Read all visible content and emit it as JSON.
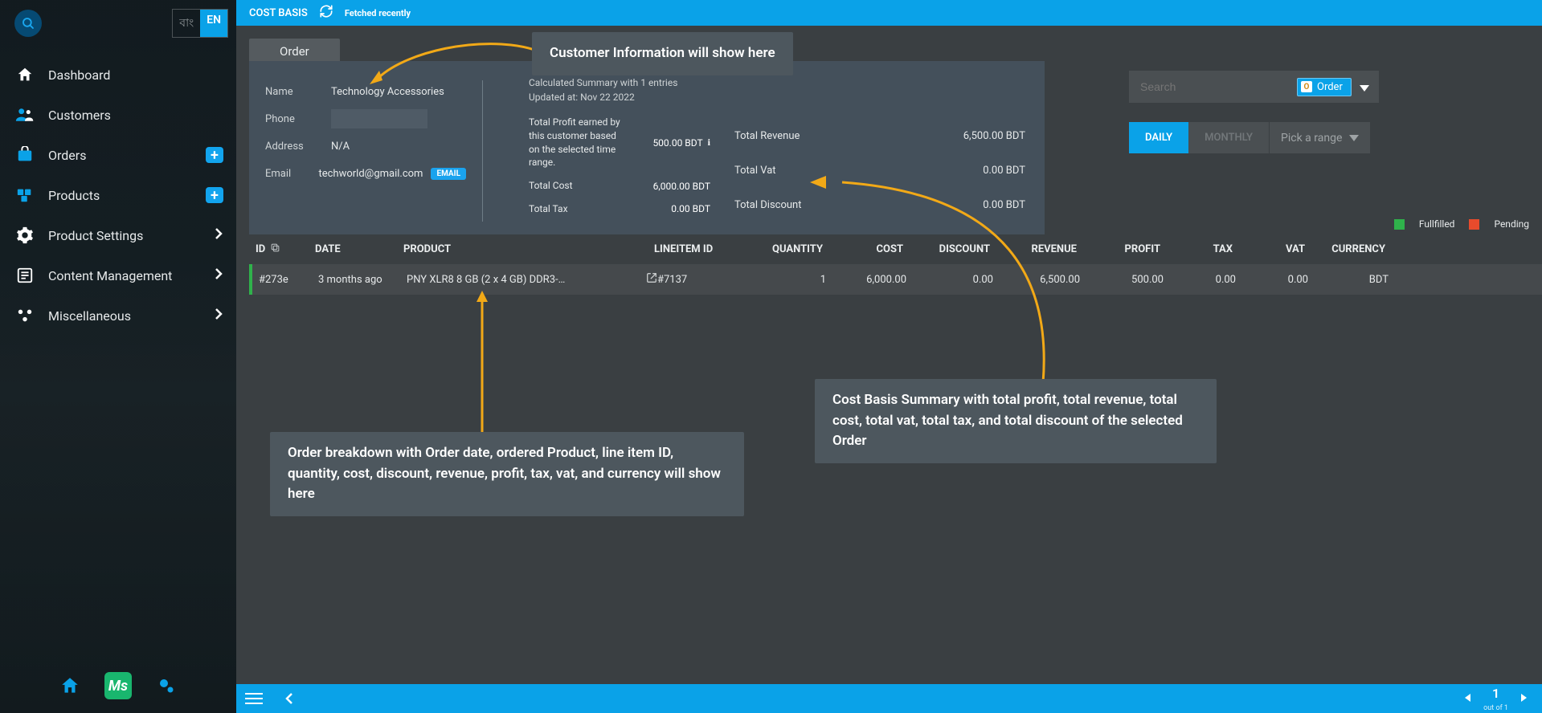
{
  "colors": {
    "accent": "#0aa2e8",
    "fulfilled": "#2fb24b",
    "pending": "#e84b2c"
  },
  "lang": {
    "inactive": "বাং",
    "active": "EN"
  },
  "sidebar": {
    "items": [
      {
        "icon": "home",
        "label": "Dashboard"
      },
      {
        "icon": "users",
        "label": "Customers"
      },
      {
        "icon": "orders",
        "label": "Orders",
        "plus": true
      },
      {
        "icon": "products",
        "label": "Products",
        "plus": true
      },
      {
        "icon": "settings",
        "label": "Product Settings",
        "chev": true
      },
      {
        "icon": "content",
        "label": "Content Management",
        "chev": true
      },
      {
        "icon": "misc",
        "label": "Miscellaneous",
        "chev": true
      }
    ]
  },
  "topbar": {
    "title": "COST BASIS",
    "fetch": "Fetched recently"
  },
  "chip": "Order",
  "customer": {
    "name_label": "Name",
    "name": "Technology Accessories",
    "phone_label": "Phone",
    "address_label": "Address",
    "address": "N/A",
    "email_label": "Email",
    "email": "techworld@gmail.com",
    "email_badge": "EMAIL"
  },
  "summary": {
    "line1": "Calculated Summary with 1 entries",
    "line2": "Updated at: Nov 22 2022",
    "profit_label": "Total Profit earned by this customer based on the selected time range.",
    "profit_value": "500.00 BDT",
    "cost_label": "Total Cost",
    "cost_value": "6,000.00 BDT",
    "tax_label": "Total Tax",
    "tax_value": "0.00 BDT",
    "revenue_label": "Total Revenue",
    "revenue_value": "6,500.00 BDT",
    "vat_label": "Total Vat",
    "vat_value": "0.00 BDT",
    "discount_label": "Total Discount",
    "discount_value": "0.00 BDT"
  },
  "search": {
    "placeholder": "Search",
    "badge_letter": "O",
    "badge_text": "Order"
  },
  "range": {
    "daily": "DAILY",
    "monthly": "MONTHLY",
    "pick": "Pick a range"
  },
  "legend": {
    "fulfilled": "Fullfilled",
    "pending": "Pending"
  },
  "table": {
    "headers": [
      "ID",
      "DATE",
      "PRODUCT",
      "LINEITEM ID",
      "QUANTITY",
      "COST",
      "DISCOUNT",
      "REVENUE",
      "PROFIT",
      "TAX",
      "VAT",
      "CURRENCY"
    ],
    "rows": [
      {
        "id": "#273e",
        "date": "3 months ago",
        "product": "PNY XLR8 8 GB (2 x 4 GB) DDR3-…",
        "lineitem": "#7137",
        "qty": "1",
        "cost": "6,000.00",
        "discount": "0.00",
        "revenue": "6,500.00",
        "profit": "500.00",
        "tax": "0.00",
        "vat": "0.00",
        "currency": "BDT"
      }
    ]
  },
  "tooltips": {
    "top": "Customer Information will show here",
    "right": "Cost Basis Summary with total profit, total revenue, total cost, total vat, total tax, and total discount of the selected Order",
    "bottom": "Order breakdown with Order date, ordered Product, line item ID, quantity, cost, discount, revenue, profit, tax, vat, and currency will show here"
  },
  "pager": {
    "page": "1",
    "of": "out of 1"
  }
}
